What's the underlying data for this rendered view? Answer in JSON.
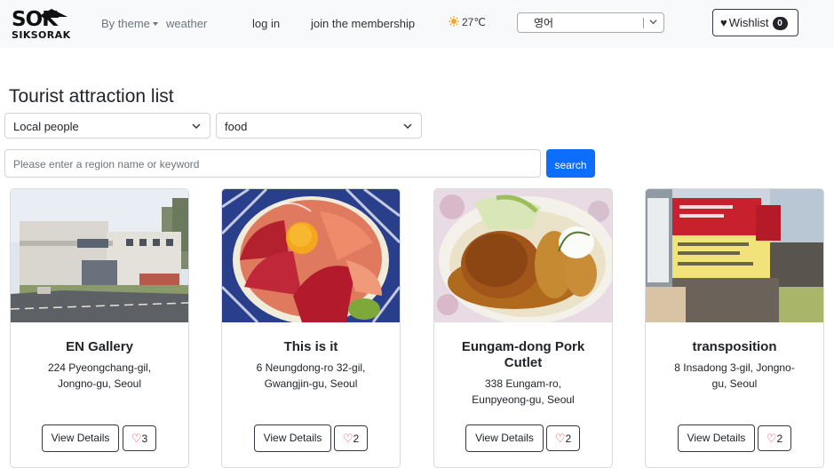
{
  "navbar": {
    "logo_mark": "SOK",
    "logo_text": "SIKSORAK",
    "by_theme": "By theme",
    "weather": "weather",
    "login": "log in",
    "join": "join the membership",
    "temperature": "27℃",
    "weather_icon": "sun-icon",
    "language": "영어",
    "wishlist_label": "Wishlist",
    "wishlist_count": "0"
  },
  "main": {
    "title": "Tourist attraction list",
    "filter_audience": "Local people",
    "filter_category": "food",
    "search_placeholder": "Please enter a region name or keyword",
    "search_button": "search"
  },
  "cards": [
    {
      "name": "EN Gallery",
      "address": "224 Pyeongchang-gil, Jongno-gu, Seoul",
      "details_label": "View Details",
      "likes": "3"
    },
    {
      "name": "This is it",
      "address": "6 Neungdong-ro 32-gil, Gwangjin-gu, Seoul",
      "details_label": "View Details",
      "likes": "2"
    },
    {
      "name": "Eungam-dong Pork Cutlet",
      "address": "338 Eungam-ro, Eunpyeong-gu, Seoul",
      "details_label": "View Details",
      "likes": "2"
    },
    {
      "name": "transposition",
      "address": "8 Insadong 3-gil, Jongno-gu, Seoul",
      "details_label": "View Details",
      "likes": "2"
    }
  ],
  "colors": {
    "navbar_bg": "#f8f9fa",
    "primary": "#0d6efd",
    "heart": "#dc3545"
  }
}
